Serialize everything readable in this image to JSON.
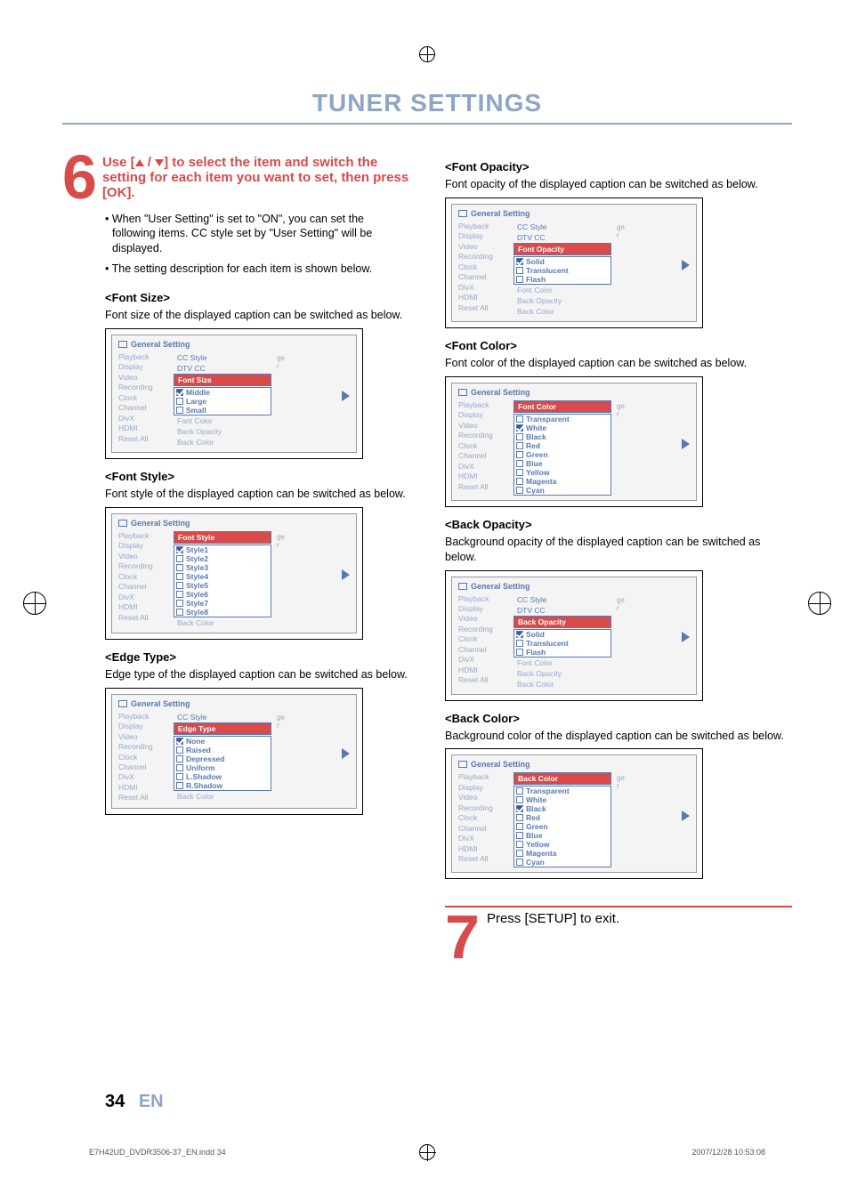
{
  "header": {
    "title": "TUNER SETTINGS"
  },
  "step6": {
    "num": "6",
    "line1_a": "Use [",
    "line1_b": " / ",
    "line1_c": "] to select the item and ",
    "line2": "switch the setting for each item you ",
    "line3": "want to set, then press [OK].",
    "bullet1": "• When \"User Setting\" is set to \"ON\", you can set the following items. CC style set by \"User Setting\" will be displayed.",
    "bullet2": "• The setting description for each item is shown below."
  },
  "step7": {
    "num": "7",
    "text": "Press [SETUP] to exit."
  },
  "nav": {
    "items": [
      "Playback",
      "Display",
      "Video",
      "Recording",
      "Clock",
      "Channel",
      "DivX",
      "HDMI",
      "Reset All"
    ],
    "gs": "General Setting",
    "right_hint_top": "ge",
    "right_hint_mid": "r"
  },
  "sec_font_size": {
    "h": "<Font Size>",
    "p": "Font size of the displayed caption can be switched as below.",
    "pre": [
      "CC Style",
      "DTV CC"
    ],
    "hl": "Font Size",
    "opts": [
      "Middle",
      "Large",
      "Small"
    ],
    "checked": 0,
    "post": [
      "Font Color",
      "Back Opacity",
      "Back Color"
    ]
  },
  "sec_font_style": {
    "h": "<Font Style>",
    "p": "Font style of the displayed caption can be switched as below.",
    "pre": [],
    "hl": "Font Style",
    "opts": [
      "Style1",
      "Style2",
      "Style3",
      "Style4",
      "Style5",
      "Style6",
      "Style7",
      "Style8"
    ],
    "checked": 0,
    "post": [
      "Back Color"
    ]
  },
  "sec_edge_type": {
    "h": "<Edge Type>",
    "p": "Edge type of the displayed caption can be switched as below.",
    "pre": [
      "CC Style"
    ],
    "hl": "Edge Type",
    "opts": [
      "None",
      "Raised",
      "Depressed",
      "Uniform",
      "L.Shadow",
      "R.Shadow"
    ],
    "checked": 0,
    "post": [
      "Back Color"
    ]
  },
  "sec_font_opacity": {
    "h": "<Font Opacity>",
    "p": "Font opacity of the displayed caption can be switched as below.",
    "pre": [
      "CC Style",
      "DTV CC"
    ],
    "hl": "Font Opacity",
    "opts": [
      "Solid",
      "Translucent",
      "Flash"
    ],
    "checked": 0,
    "post": [
      "Font Color",
      "Back Opacity",
      "Back Color"
    ]
  },
  "sec_font_color": {
    "h": "<Font Color>",
    "p": "Font color of the displayed caption can be switched as below.",
    "pre": [],
    "hl": "Font Color",
    "opts": [
      "Transparent",
      "White",
      "Black",
      "Red",
      "Green",
      "Blue",
      "Yellow",
      "Magenta",
      "Cyan"
    ],
    "checked": 1,
    "post": []
  },
  "sec_back_opacity": {
    "h": "<Back Opacity>",
    "p": "Background opacity of the displayed caption can be switched as below.",
    "pre": [
      "CC Style",
      "DTV CC"
    ],
    "hl": "Back Opacity",
    "opts": [
      "Solid",
      "Translucent",
      "Flash"
    ],
    "checked": 0,
    "post": [
      "Font Color",
      "Back Opacity",
      "Back Color"
    ]
  },
  "sec_back_color": {
    "h": "<Back Color>",
    "p": "Background color of the displayed caption can be switched as below.",
    "pre": [],
    "hl": "Back Color",
    "opts": [
      "Transparent",
      "White",
      "Black",
      "Red",
      "Green",
      "Blue",
      "Yellow",
      "Magenta",
      "Cyan"
    ],
    "checked": 2,
    "post": []
  },
  "pagenum": {
    "n": "34",
    "lang": "EN"
  },
  "footer": {
    "left": "E7H42UD_DVDR3506-37_EN.indd   34",
    "right": "2007/12/28   10:53:08"
  }
}
